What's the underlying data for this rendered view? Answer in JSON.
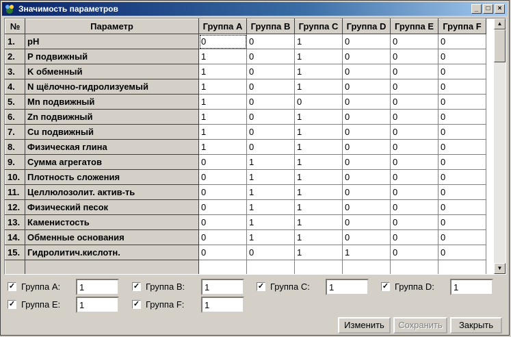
{
  "window": {
    "title": "Значимость параметров",
    "minimize_glyph": "_",
    "maximize_glyph": "□",
    "close_glyph": "×"
  },
  "grid": {
    "columns": [
      "№",
      "Параметр",
      "Группа A",
      "Группа B",
      "Группа C",
      "Группа D",
      "Группа E",
      "Группа F"
    ],
    "rows": [
      {
        "num": "1.",
        "name": "pH",
        "values": [
          "0",
          "0",
          "1",
          "0",
          "0",
          "0"
        ]
      },
      {
        "num": "2.",
        "name": "P подвижный",
        "values": [
          "1",
          "0",
          "1",
          "0",
          "0",
          "0"
        ]
      },
      {
        "num": "3.",
        "name": "K обменный",
        "values": [
          "1",
          "0",
          "1",
          "0",
          "0",
          "0"
        ]
      },
      {
        "num": "4.",
        "name": "N щёлочно-гидролизуемый",
        "values": [
          "1",
          "0",
          "1",
          "0",
          "0",
          "0"
        ]
      },
      {
        "num": "5.",
        "name": "Mn подвижный",
        "values": [
          "1",
          "0",
          "0",
          "0",
          "0",
          "0"
        ]
      },
      {
        "num": "6.",
        "name": "Zn подвижный",
        "values": [
          "1",
          "0",
          "1",
          "0",
          "0",
          "0"
        ]
      },
      {
        "num": "7.",
        "name": "Cu подвижный",
        "values": [
          "1",
          "0",
          "1",
          "0",
          "0",
          "0"
        ]
      },
      {
        "num": "8.",
        "name": "Физическая глина",
        "values": [
          "1",
          "0",
          "1",
          "0",
          "0",
          "0"
        ]
      },
      {
        "num": "9.",
        "name": "Сумма агрегатов",
        "values": [
          "0",
          "1",
          "1",
          "0",
          "0",
          "0"
        ]
      },
      {
        "num": "10.",
        "name": "Плотность сложения",
        "values": [
          "0",
          "1",
          "1",
          "0",
          "0",
          "0"
        ]
      },
      {
        "num": "11.",
        "name": "Целлюлозолит. актив-ть",
        "values": [
          "0",
          "1",
          "1",
          "0",
          "0",
          "0"
        ]
      },
      {
        "num": "12.",
        "name": "Физический песок",
        "values": [
          "0",
          "1",
          "1",
          "0",
          "0",
          "0"
        ]
      },
      {
        "num": "13.",
        "name": "Каменистость",
        "values": [
          "0",
          "1",
          "1",
          "0",
          "0",
          "0"
        ]
      },
      {
        "num": "14.",
        "name": "Обменные основания",
        "values": [
          "0",
          "1",
          "1",
          "0",
          "0",
          "0"
        ]
      },
      {
        "num": "15.",
        "name": "Гидролитич.кислотн.",
        "values": [
          "0",
          "0",
          "1",
          "1",
          "0",
          "0"
        ]
      },
      {
        "num": "",
        "name": "",
        "values": [
          "",
          "",
          "",
          "",
          "",
          ""
        ]
      }
    ],
    "scroll_up_glyph": "▲",
    "scroll_down_glyph": "▼"
  },
  "groups": [
    {
      "label": "Группа A:",
      "checked": true,
      "value": "1"
    },
    {
      "label": "Группа B:",
      "checked": true,
      "value": "1"
    },
    {
      "label": "Группа C:",
      "checked": true,
      "value": "1"
    },
    {
      "label": "Группа D:",
      "checked": true,
      "value": "1"
    },
    {
      "label": "Группа E:",
      "checked": true,
      "value": "1"
    },
    {
      "label": "Группа F:",
      "checked": true,
      "value": "1"
    }
  ],
  "check_glyph": "✓",
  "buttons": {
    "edit": "Изменить",
    "save": "Сохранить",
    "close": "Закрыть"
  }
}
